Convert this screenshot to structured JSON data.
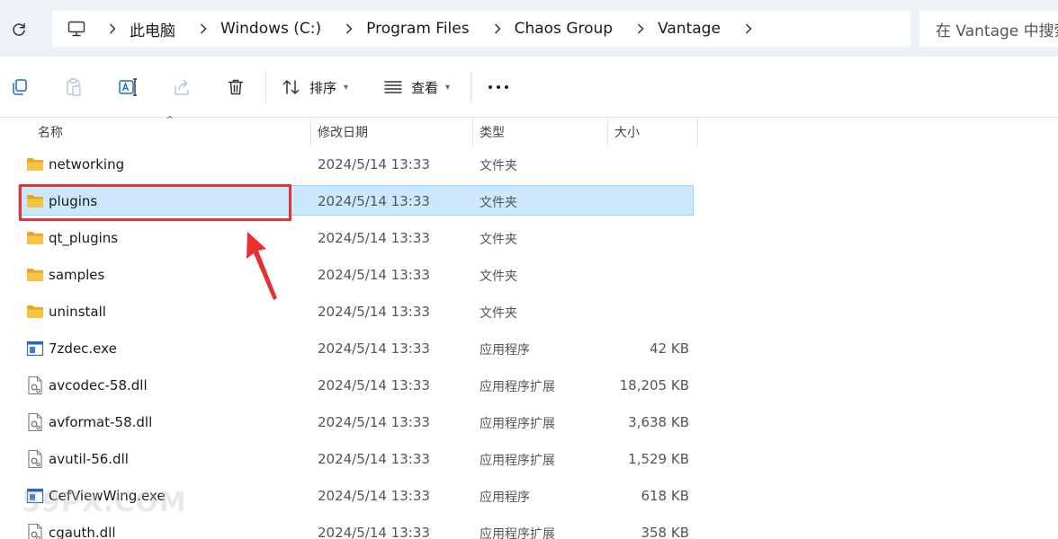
{
  "address_bar": {
    "breadcrumbs": [
      "此电脑",
      "Windows (C:)",
      "Program Files",
      "Chaos Group",
      "Vantage"
    ],
    "search_placeholder": "在 Vantage 中搜索"
  },
  "command_bar": {
    "sort_label": "排序",
    "view_label": "查看"
  },
  "columns": {
    "name": "名称",
    "date": "修改日期",
    "type": "类型",
    "size": "大小"
  },
  "files": [
    {
      "name": "networking",
      "date": "2024/5/14 13:33",
      "type": "文件夹",
      "size": "",
      "icon": "folder-icon"
    },
    {
      "name": "plugins",
      "date": "2024/5/14 13:33",
      "type": "文件夹",
      "size": "",
      "icon": "folder-icon",
      "selected": true
    },
    {
      "name": "qt_plugins",
      "date": "2024/5/14 13:33",
      "type": "文件夹",
      "size": "",
      "icon": "folder-icon"
    },
    {
      "name": "samples",
      "date": "2024/5/14 13:33",
      "type": "文件夹",
      "size": "",
      "icon": "folder-icon"
    },
    {
      "name": "uninstall",
      "date": "2024/5/14 13:33",
      "type": "文件夹",
      "size": "",
      "icon": "folder-icon"
    },
    {
      "name": "7zdec.exe",
      "date": "2024/5/14 13:33",
      "type": "应用程序",
      "size": "42 KB",
      "icon": "exe-icon"
    },
    {
      "name": "avcodec-58.dll",
      "date": "2024/5/14 13:33",
      "type": "应用程序扩展",
      "size": "18,205 KB",
      "icon": "dll-icon"
    },
    {
      "name": "avformat-58.dll",
      "date": "2024/5/14 13:33",
      "type": "应用程序扩展",
      "size": "3,638 KB",
      "icon": "dll-icon"
    },
    {
      "name": "avutil-56.dll",
      "date": "2024/5/14 13:33",
      "type": "应用程序扩展",
      "size": "1,529 KB",
      "icon": "dll-icon"
    },
    {
      "name": "CefViewWing.exe",
      "date": "2024/5/14 13:33",
      "type": "应用程序",
      "size": "618 KB",
      "icon": "exe-icon"
    },
    {
      "name": "cgauth.dll",
      "date": "2024/5/14 13:33",
      "type": "应用程序扩展",
      "size": "358 KB",
      "icon": "dll-icon"
    }
  ],
  "watermark": "59PX.COM",
  "colors": {
    "selection": "#cce8ff",
    "annotation": "#e83030",
    "folder": "#f5c445"
  }
}
